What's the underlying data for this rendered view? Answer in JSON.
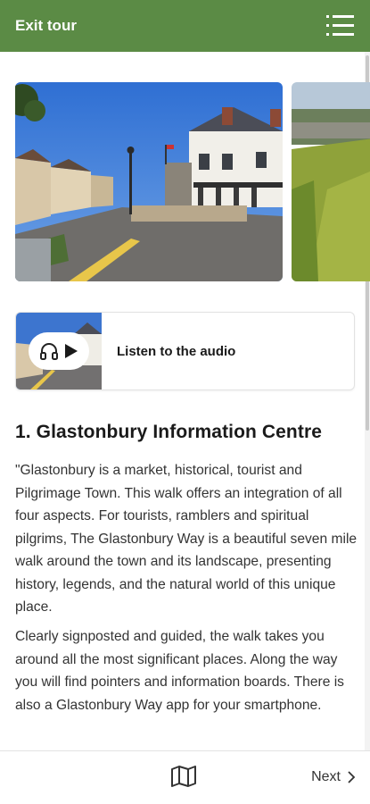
{
  "header": {
    "exit_label": "Exit tour",
    "background": "#5b8b45"
  },
  "gallery": {
    "images": [
      {
        "subject": "Glastonbury town square with white building"
      },
      {
        "subject": "Green hillside overlooking town"
      }
    ]
  },
  "audio": {
    "label": "Listen to the audio",
    "icons": [
      "headphones-icon",
      "play-icon"
    ]
  },
  "stop": {
    "title": "1. Glastonbury Information Centre",
    "paragraphs": [
      "\"Glastonbury is a market, historical, tourist and Pilgrimage Town. This walk offers an integration of all four aspects. For tourists, ramblers and spiritual pilgrims, The Glastonbury Way is a beautiful seven mile walk around the town and its landscape, presenting history, legends, and the natural world of this unique place.",
      "Clearly signposted and guided, the walk takes you around all the most significant places. Along the way you will find pointers and information boards. There is also a Glastonbury Way app for your smartphone."
    ]
  },
  "footer": {
    "next_label": "Next",
    "icons": [
      "map-icon",
      "chevron-right-icon"
    ]
  }
}
